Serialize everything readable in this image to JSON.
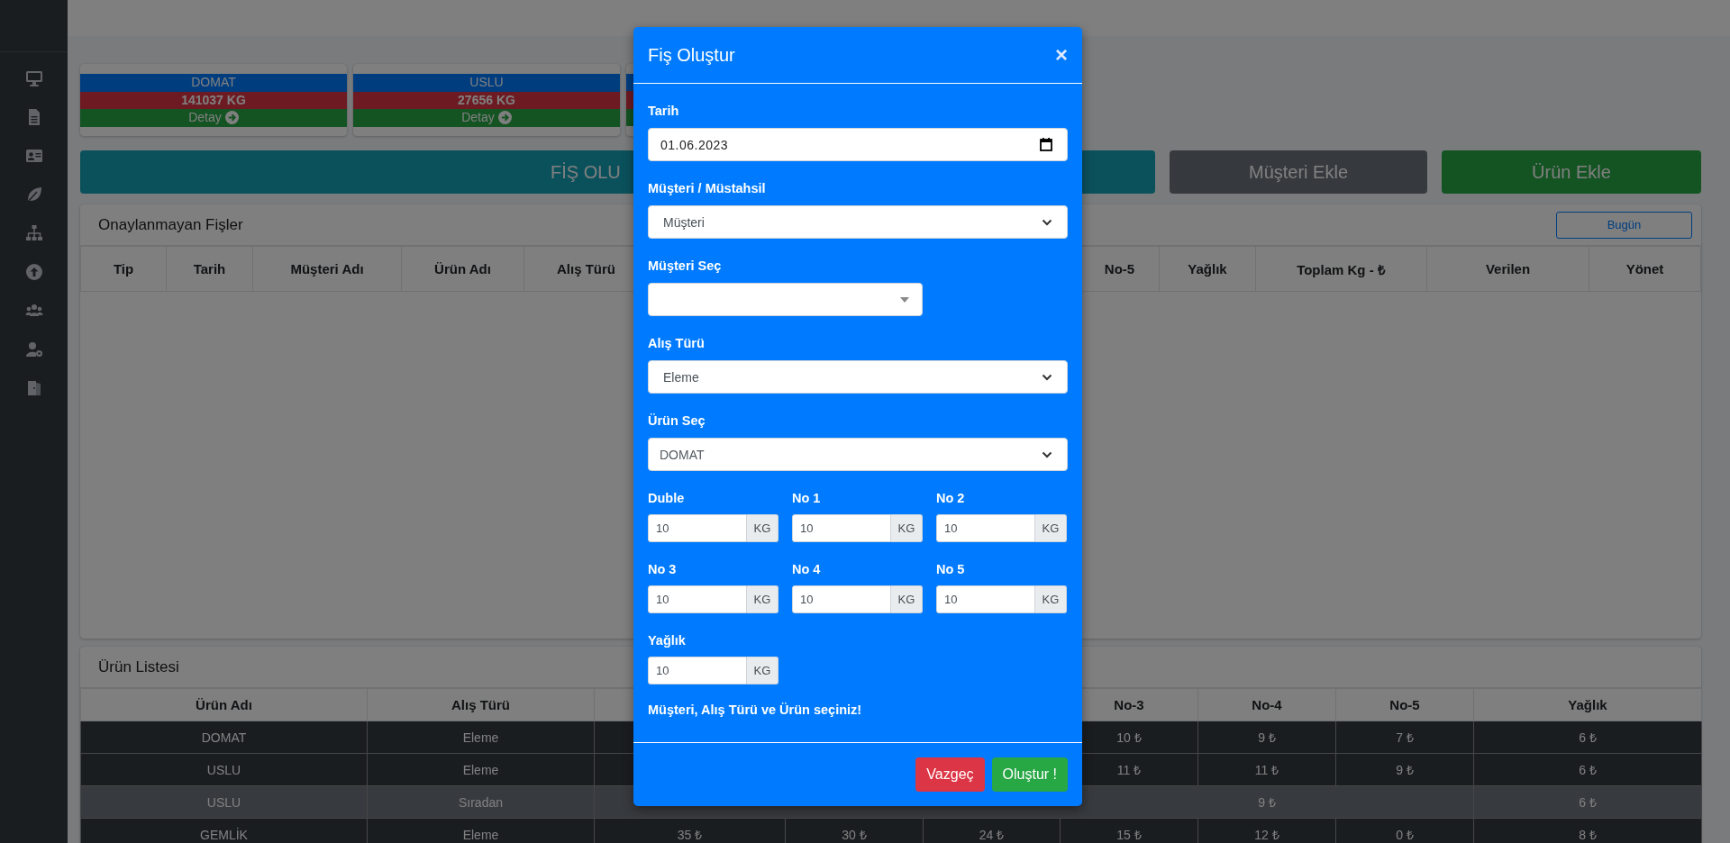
{
  "summary_cards": [
    {
      "product": "DOMAT",
      "amount": "141037 KG",
      "link": "Detay"
    },
    {
      "product": "USLU",
      "amount": "27656 KG",
      "link": "Detay"
    }
  ],
  "actions": [
    {
      "label": "FİŞ OLU",
      "kind": "primary"
    },
    {
      "label": "Müşteri Ekle",
      "kind": "secondary"
    },
    {
      "label": "Ürün Ekle",
      "kind": "success"
    }
  ],
  "pending_receipts": {
    "title": "Onaylanmayan Fişler",
    "filter_button": "Bugün",
    "columns": [
      "Tip",
      "Tarih",
      "Müşteri Adı",
      "Ürün Adı",
      "Alış Türü",
      null,
      "No-5",
      "Yağlık",
      "Toplam Kg - ₺",
      "Verilen",
      "Yönet"
    ]
  },
  "product_list": {
    "title": "Ürün Listesi",
    "columns": [
      "Ürün Adı",
      "Alış Türü",
      null,
      null,
      null,
      "No-3",
      "No-4",
      "No-5",
      "Yağlık"
    ],
    "rows": [
      {
        "highlighted": false,
        "cells": [
          "DOMAT",
          "Eleme",
          null,
          null,
          null,
          "10 ₺",
          "9 ₺",
          "7 ₺",
          "6 ₺"
        ]
      },
      {
        "highlighted": false,
        "cells": [
          "USLU",
          "Eleme",
          null,
          null,
          null,
          "11 ₺",
          "11 ₺",
          "9 ₺",
          "6 ₺"
        ]
      },
      {
        "highlighted": true,
        "cells": [
          "USLU",
          "Sıradan",
          null,
          null,
          null,
          null,
          "9 ₺",
          null,
          "6 ₺"
        ]
      },
      {
        "highlighted": false,
        "cells": [
          "GEMLİK",
          "Eleme",
          "35 ₺",
          "30 ₺",
          "24 ₺",
          "15 ₺",
          "12 ₺",
          "0 ₺",
          "8 ₺"
        ]
      }
    ]
  },
  "modal": {
    "title": "Fiş Oluştur",
    "close": "×",
    "fields": [
      {
        "kind": "date",
        "label": "Tarih",
        "value": "01.06.2023"
      },
      {
        "kind": "select",
        "label": "Müşteri / Müstahsil",
        "value": "Müşteri"
      },
      {
        "kind": "search_select",
        "label": "Müşteri Seç"
      },
      {
        "kind": "select",
        "label": "Alış Türü",
        "value": "Eleme"
      },
      {
        "kind": "select",
        "label": "Ürün Seç",
        "value": "DOMAT"
      }
    ],
    "quantities": [
      {
        "label": "Duble",
        "value": "10",
        "unit": "KG"
      },
      {
        "label": "No 1",
        "value": "10",
        "unit": "KG"
      },
      {
        "label": "No 2",
        "value": "10",
        "unit": "KG"
      },
      {
        "label": "No 3",
        "value": "10",
        "unit": "KG"
      },
      {
        "label": "No 4",
        "value": "10",
        "unit": "KG"
      },
      {
        "label": "No 5",
        "value": "10",
        "unit": "KG"
      },
      {
        "label": "Yağlık",
        "value": "10",
        "unit": "KG"
      }
    ],
    "message": "Müşteri, Alış Türü ve Ürün seçiniz!",
    "buttons": [
      {
        "label": "Vazgeç",
        "kind": "cancel"
      },
      {
        "label": "Oluştur !",
        "kind": "confirm"
      }
    ]
  }
}
